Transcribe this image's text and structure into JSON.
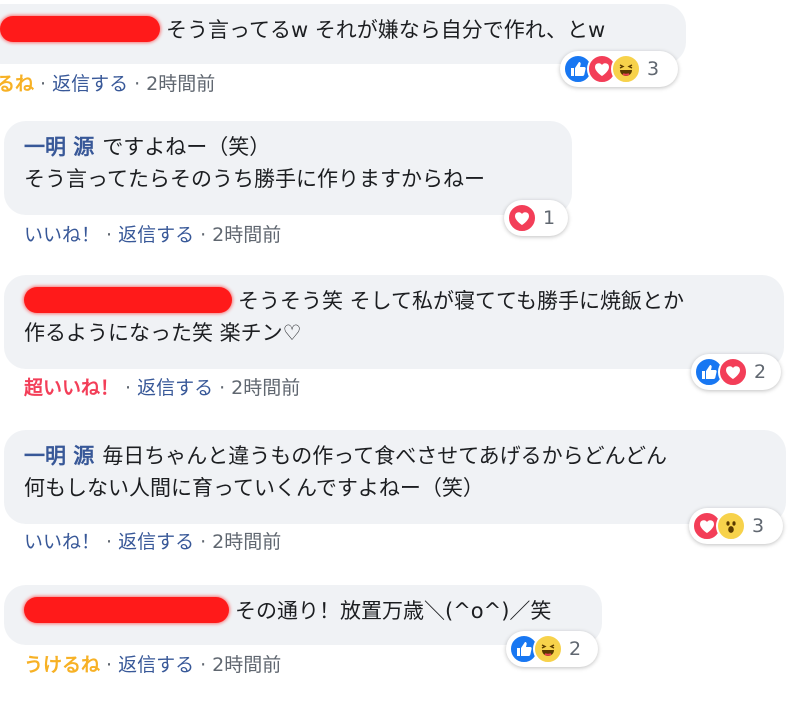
{
  "comments": [
    {
      "text": "そう言ってるw それが嫌なら自分で作れ、とw",
      "actions": {
        "reaction": "るね",
        "reaction_color": "#f7b125",
        "reply": "返信する",
        "time": "2時間前"
      },
      "reactions": {
        "icons": [
          "like-icon",
          "love-icon",
          "haha-icon"
        ],
        "count": "3"
      }
    },
    {
      "author": "一明 源",
      "line1": "ですよねー（笑）",
      "line2": "そう言ってたらそのうち勝手に作りますからねー",
      "actions": {
        "reaction": "いいね！",
        "reaction_color": "#385898",
        "reply": "返信する",
        "time": "2時間前"
      },
      "reactions": {
        "icons": [
          "love-icon"
        ],
        "count": "1"
      }
    },
    {
      "line1": "そうそう笑 そして私が寝てても勝手に焼飯とか",
      "line2": "作るようになった笑 楽チン♡",
      "actions": {
        "reaction": "超いいね！",
        "reaction_color": "#f33e58",
        "reply": "返信する",
        "time": "2時間前"
      },
      "reactions": {
        "icons": [
          "like-icon",
          "love-icon"
        ],
        "count": "2"
      }
    },
    {
      "author": "一明 源",
      "line1": "毎日ちゃんと違うもの作って食べさせてあげるからどんどん",
      "line2": "何もしない人間に育っていくんですよねー（笑）",
      "actions": {
        "reaction": "いいね！",
        "reaction_color": "#385898",
        "reply": "返信する",
        "time": "2時間前"
      },
      "reactions": {
        "icons": [
          "love-icon",
          "wow-icon"
        ],
        "count": "3"
      }
    },
    {
      "text": "その通り！放置万歳＼(^o^)／笑",
      "actions": {
        "reaction": "うけるね",
        "reaction_color": "#f7b125",
        "reply": "返信する",
        "time": "2時間前"
      },
      "reactions": {
        "icons": [
          "like-icon",
          "haha-icon"
        ],
        "count": "2"
      }
    }
  ],
  "separator": "·"
}
